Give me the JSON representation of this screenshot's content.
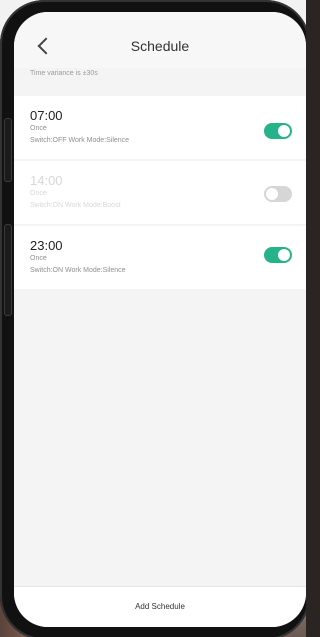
{
  "header": {
    "title": "Schedule"
  },
  "variance_text": "Time variance is ±30s",
  "schedules": [
    {
      "time": "07:00",
      "repeat": "Once",
      "details": "Switch:OFF  Work Mode:Silence",
      "enabled": true
    },
    {
      "time": "14:00",
      "repeat": "Once",
      "details": "Switch:ON  Work Mode:Boost",
      "enabled": false
    },
    {
      "time": "23:00",
      "repeat": "Once",
      "details": "Switch:ON  Work Mode:Silence",
      "enabled": true
    }
  ],
  "footer": {
    "add_label": "Add Schedule"
  },
  "colors": {
    "accent": "#26b38a"
  }
}
